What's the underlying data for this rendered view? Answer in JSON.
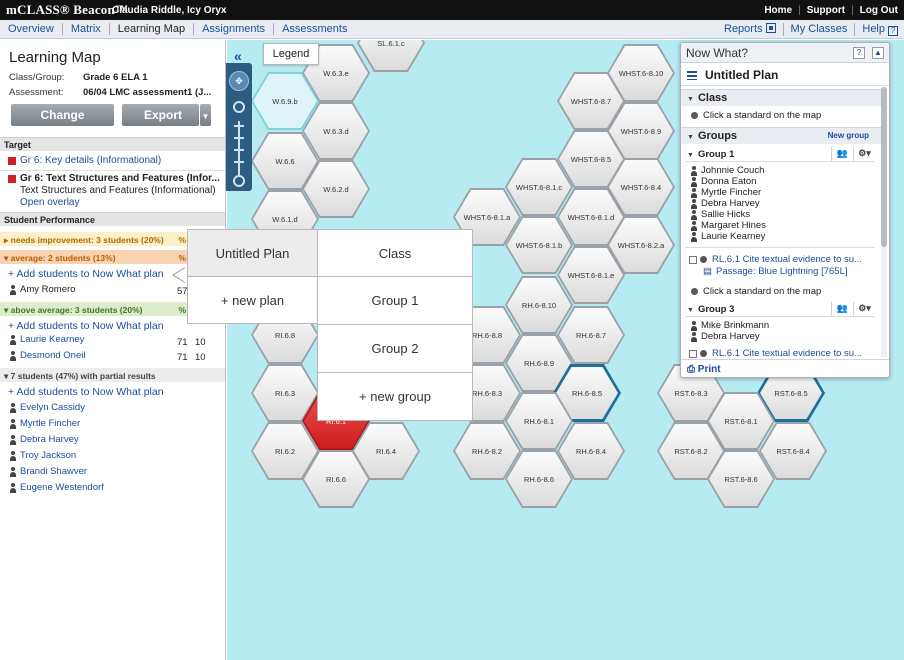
{
  "topbar": {
    "brand": "mCLASS® Beacon™",
    "user": "Claudia Riddle, Icy Oryx",
    "links": [
      "Home",
      "Support",
      "Log Out"
    ]
  },
  "nav": {
    "tabs": [
      "Overview",
      "Matrix",
      "Learning Map",
      "Assignments",
      "Assessments"
    ],
    "active": "Learning Map",
    "right": [
      "Reports",
      "My Classes",
      "Help"
    ]
  },
  "left": {
    "title": "Learning Map",
    "class_label": "Class/Group:",
    "class_value": "Grade 6 ELA 1",
    "assessment_label": "Assessment:",
    "assessment_value": "06/04 LMC assessment1 (J...",
    "change_button": "Change Selections",
    "export_button": "Export",
    "target_header": "Target",
    "target_1": "Gr 6: Key details (Informational)",
    "target_2_title": "Gr 6: Text Structures and Features (Infor...",
    "target_2_sub": "Text Structures and Features (Informational)",
    "open_overlay": "Open overlay",
    "perf_header": "Student Performance",
    "bands": {
      "needs": "needs improvement: 3 students (20%)",
      "avg": "average: 2 students (13%)",
      "above": "above average: 3 students (20%)",
      "partial": "7 students (47%) with partial results",
      "pct": "%"
    },
    "add_link": "+ Add students to Now What plan",
    "avg_students": [
      {
        "name": "Amy Romero",
        "s1": "57",
        "s2": ""
      }
    ],
    "above_students": [
      {
        "name": "Laurie Kearney",
        "s1": "71",
        "s2": "10"
      },
      {
        "name": "Desmond Oneil",
        "s1": "71",
        "s2": "10"
      }
    ],
    "partial_students": [
      "Evelyn Cassidy",
      "Myrtle Fincher",
      "Debra Harvey",
      "Troy Jackson",
      "Brandi Shawver",
      "Eugene Westendorf"
    ]
  },
  "map": {
    "legend": "Legend",
    "hexes": [
      "SL.6.1.c",
      "W.6.3.e",
      "W.6.9.b",
      "W.6.3.d",
      "W.6.6",
      "W.6.2.d",
      "W.6.1.d",
      "RI.6.8",
      "RI.6.3",
      "RI.6.1",
      "RI.6.2",
      "RI.6.4",
      "RI.6.6",
      "WHST.6-8.10",
      "WHST.6-8.7",
      "WHST.6-8.9",
      "WHST.6-8.5",
      "WHST.6-8.1.c",
      "WHST.6-8.4",
      "WHST.6-8.1.a",
      "WHST.6-8.1.d",
      "WHST.6-8.2.a",
      "WHST.6-8.1.b",
      "WHST.6-8.1.e",
      "RH.6-8.10",
      "RH.6-8.8",
      "RH.6-8.7",
      "RH.6-8.9",
      "RH.6-8.3",
      "RH.6-8.5",
      "RH.6-8.1",
      "RH.6-8.2",
      "RH.6-8.4",
      "RH.6-8.6",
      "RST.6-8.3",
      "RST.6-8.5",
      "RST.6-8.1",
      "RST.6-8.2",
      "RST.6-8.4",
      "RST.6-8.6"
    ]
  },
  "popup": {
    "plan": "Untitled Plan",
    "new_plan": "+ new plan",
    "class": "Class",
    "group1": "Group 1",
    "group2": "Group 2",
    "new_group": "+ new group"
  },
  "nowwhat": {
    "title": "Now What?",
    "plan": "Untitled Plan",
    "class": "Class",
    "click_standard": "Click a standard on the map",
    "groups": "Groups",
    "new_group": "New group",
    "group1": "Group 1",
    "group1_students": [
      "Johnnie Couch",
      "Donna Eaton",
      "Myrtle Fincher",
      "Debra Harvey",
      "Sallie Hicks",
      "Margaret Hines",
      "Laurie Kearney"
    ],
    "standard": "RL.6.1 Cite textual evidence to su...",
    "passage": "Passage: Blue Lightning [765L]",
    "group3": "Group 3",
    "group3_students": [
      "Mike Brinkmann",
      "Debra Harvey"
    ],
    "standard2": "RL.6.1 Cite textual evidence to su...",
    "print": "Print"
  }
}
